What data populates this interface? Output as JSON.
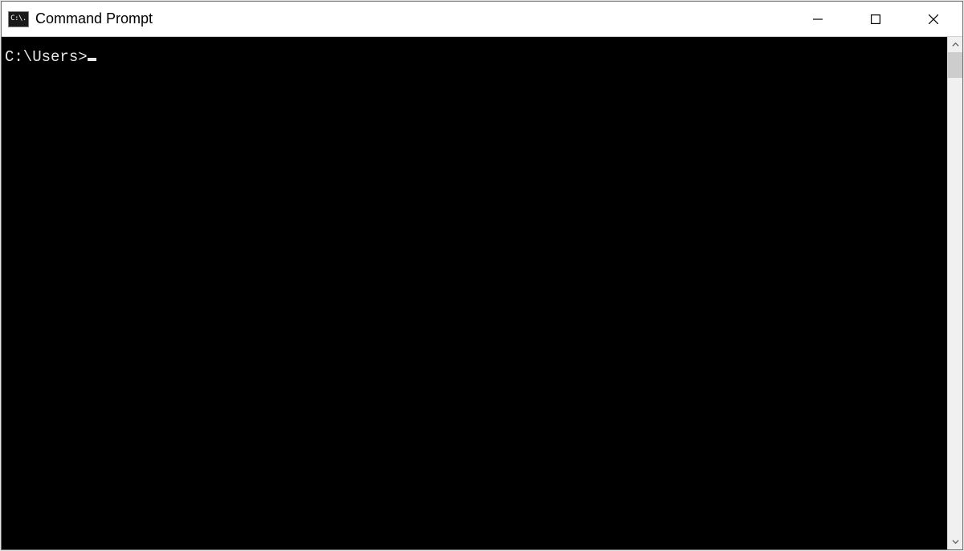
{
  "window": {
    "title": "Command Prompt",
    "icon_text": "C:\\."
  },
  "terminal": {
    "prompt": "C:\\Users>"
  }
}
